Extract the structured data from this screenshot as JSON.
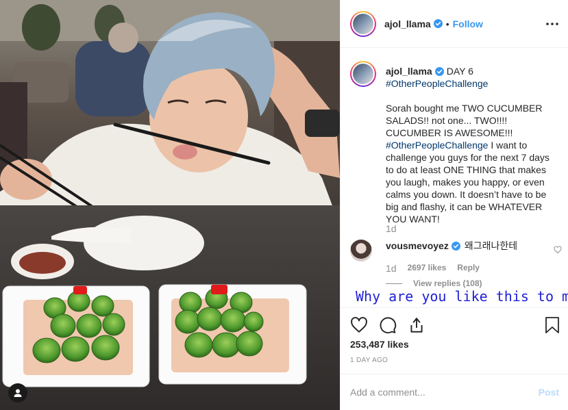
{
  "post": {
    "author": "ajol_llama",
    "follow_label": "Follow",
    "separator": "•",
    "caption": {
      "author": "ajol_llama",
      "day": "DAY 6",
      "hashtag_line": "#OtherPeopleChallenge",
      "body_part1": "Sorah bought me TWO CUCUMBER SALADS!! not one... TWO!!!! CUCUMBER IS AWESOME!!! ",
      "body_hashtag": "#OtherPeopleChallenge",
      "body_part2": " I want to challenge you guys for the next 7 days to do at least ONE THING that makes you laugh, makes you happy, or even calms you down. It doesn’t have to be big and flashy, it can be WHATEVER YOU WANT!",
      "time": "1d"
    },
    "comment": {
      "author": "vousmevoyez",
      "text": "왜그래나한테",
      "time": "1d",
      "likes": "2697 likes",
      "reply_label": "Reply",
      "view_replies": "View replies (108)"
    },
    "overlay_text": "Why are you like this to me",
    "likes": "253,487 likes",
    "date": "1 DAY AGO",
    "add_comment_placeholder": "Add a comment...",
    "post_button": "Post"
  },
  "icons": {
    "verified": "verified-badge-icon",
    "more": "more-options-icon",
    "like": "heart-icon",
    "comment": "comment-icon",
    "share": "share-icon",
    "save": "bookmark-icon",
    "tag": "user-tag-icon"
  },
  "colors": {
    "link": "#3897f0",
    "hashtag": "#00376b",
    "muted": "#8e8e8e",
    "overlay": "#1e1ed6",
    "post_disabled": "#b9dcfb"
  }
}
